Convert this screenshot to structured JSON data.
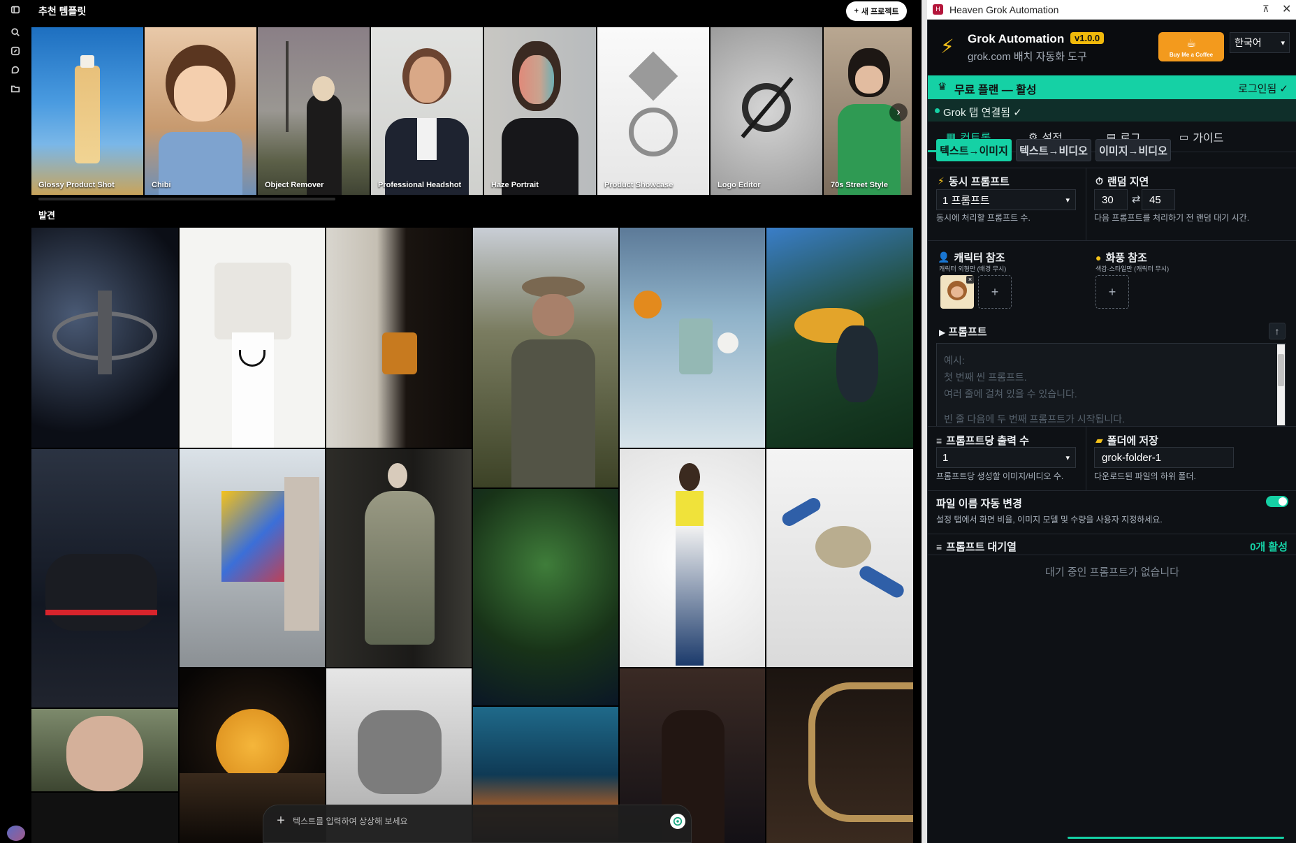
{
  "app": {
    "templates_title": "추천 템플릿",
    "new_project_label": "새 프로젝트",
    "discover_title": "발견",
    "composer_placeholder": "텍스트를 입력하여 상상해 보세요"
  },
  "templates": [
    {
      "label": "Glossy Product Shot"
    },
    {
      "label": "Chibi"
    },
    {
      "label": "Object Remover"
    },
    {
      "label": "Professional Headshot"
    },
    {
      "label": "Haze Portrait"
    },
    {
      "label": "Product Showcase"
    },
    {
      "label": "Logo Editor"
    },
    {
      "label": "70s Street Style"
    }
  ],
  "extension": {
    "window_title": "Heaven Grok Automation",
    "title": "Grok Automation",
    "version": "v1.0.0",
    "subtitle": "grok.com 배치 자동화 도구",
    "coffee_label": "Buy Me a Coffee",
    "language": "한국어",
    "plan_text": "무료 플랜 — 활성",
    "login_status": "로그인됨 ✓",
    "connection_status": "Grok 탭 연결됨 ✓",
    "tabs": [
      {
        "icon": "grid-icon",
        "label": "컨트롤"
      },
      {
        "icon": "gear-icon",
        "label": "설정"
      },
      {
        "icon": "clipboard-icon",
        "label": "로그"
      },
      {
        "icon": "book-icon",
        "label": "가이드"
      }
    ],
    "modes": [
      "텍스트→이미지",
      "텍스트→비디오",
      "이미지→비디오"
    ],
    "concurrent": {
      "title": "동시 프롬프트",
      "value": "1 프롬프트",
      "help": "동시에 처리할 프롬프트 수."
    },
    "delay": {
      "title": "랜덤 지연",
      "min": "30",
      "max": "45",
      "help": "다음 프롬프트를 처리하기 전 랜덤 대기 시간."
    },
    "char_ref": {
      "title": "캐릭터 참조",
      "sub": "캐릭터 외형만 (배경 무시)"
    },
    "style_ref": {
      "title": "화풍 참조",
      "sub": "색감·스타일만 (캐릭터 무시)"
    },
    "prompt": {
      "title": "프롬프트",
      "placeholder_lines": [
        "예시:",
        "첫 번째 씬 프롬프트.",
        "여러 줄에 걸쳐 있을 수 있습니다.",
        "",
        "빈 줄 다음에 두 번째 프롬프트가 시작됩니다."
      ]
    },
    "outputs": {
      "title": "프롬프트당 출력 수",
      "value": "1",
      "help": "프롬프트당 생성할 이미지/비디오 수."
    },
    "folder": {
      "title": "폴더에 저장",
      "value": "grok-folder-1",
      "help": "다운로드된 파일의 하위 폴더."
    },
    "auto_rename": {
      "title": "파일 이름 자동 변경",
      "help": "설정 탭에서 화면 비율, 이미지 모델 및 수량을 사용자 지정하세요.",
      "enabled": true
    },
    "queue": {
      "title": "프롬프트 대기열",
      "count": "0개 활성",
      "empty": "대기 중인 프롬프트가 없습니다"
    }
  },
  "colors": {
    "accent": "#15d1a5",
    "version_badge": "#f0b90b",
    "coffee": "#f39a1d",
    "panel_bg": "#0e1115"
  }
}
